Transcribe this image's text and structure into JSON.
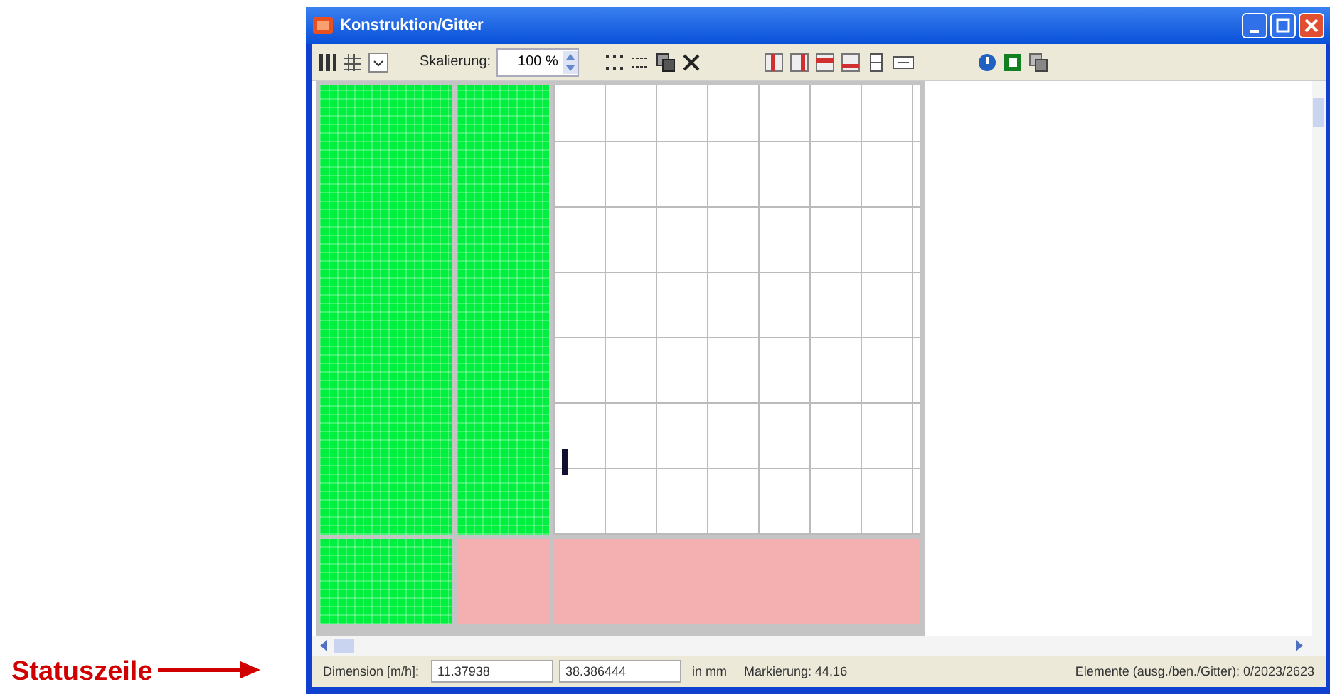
{
  "callout": {
    "label": "Statuszeile"
  },
  "window": {
    "title": "Konstruktion/Gitter"
  },
  "toolbar": {
    "scale_label": "Skalierung:",
    "scale_value": "100 %"
  },
  "canvas": {
    "cells": [
      {
        "color": "#00f040",
        "kind": "filled"
      },
      {
        "color": "#00f040",
        "kind": "filled"
      },
      {
        "color": "#ffffff",
        "kind": "grid"
      },
      {
        "color": "#00f040",
        "kind": "filled"
      },
      {
        "color": "#f4b0b0",
        "kind": "plain"
      },
      {
        "color": "#f4b0b0",
        "kind": "plain"
      }
    ]
  },
  "status_bar": [
    "Dimension [m/h]:",
    "11.37938",
    "38.386444",
    "in mm",
    "Markierung: 44,16",
    "Elemente (ausg./ben./Gitter): 0/2023/2623"
  ]
}
